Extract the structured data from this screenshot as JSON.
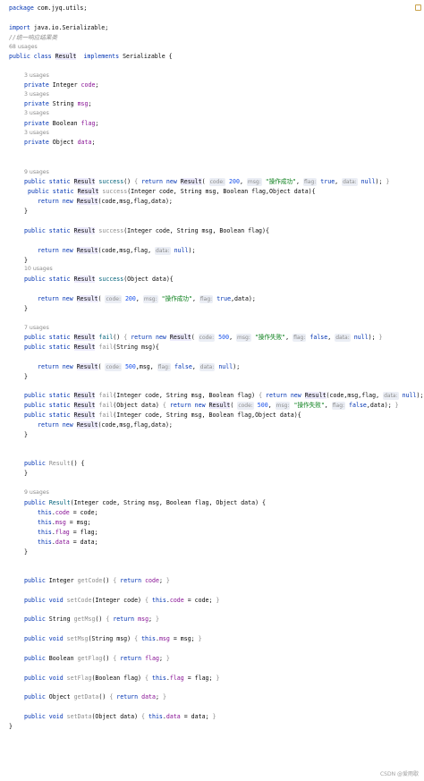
{
  "source": {
    "pkg": "package com.jyq.utils;",
    "import": "import java.io.Serializable;",
    "comment": "//统一响应结果类",
    "usages": {
      "u68": "68 usages",
      "u3": "3 usages",
      "u9": "9 usages",
      "u10": "10 usages",
      "u7": "7 usages"
    },
    "hints": {
      "code": "code:",
      "msg": "msg:",
      "flag": "flag:",
      "data": "data:"
    },
    "str_success": "\"操作成功\"",
    "str_fail": "\"操作失败\"",
    "n200": "200",
    "n500": "500"
  },
  "watermark": "CSDN @爱雨歇"
}
